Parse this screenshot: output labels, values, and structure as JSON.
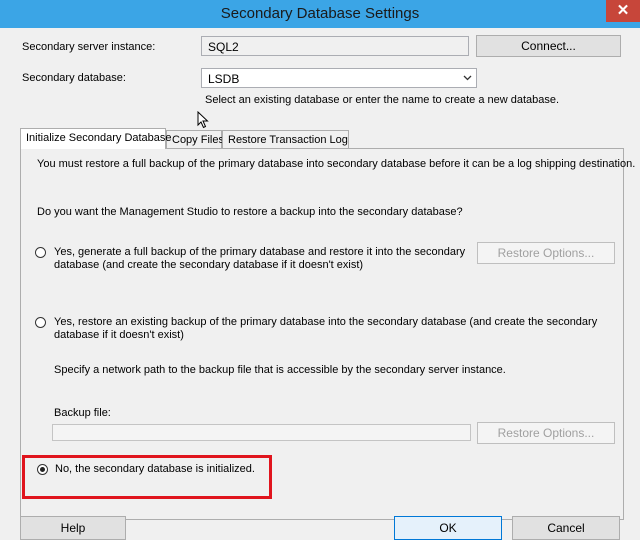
{
  "window": {
    "title": "Secondary Database Settings",
    "close_glyph": "✕"
  },
  "server": {
    "label": "Secondary server instance:",
    "value": "SQL2",
    "connect_button": "Connect..."
  },
  "database": {
    "label": "Secondary database:",
    "value": "LSDB",
    "hint": "Select an existing database or enter the name to create a new database."
  },
  "tabs": [
    {
      "label": "Initialize Secondary Database",
      "active": true
    },
    {
      "label": "Copy Files",
      "active": false
    },
    {
      "label": "Restore Transaction Log",
      "active": false
    }
  ],
  "panel": {
    "intro": "You must restore a full backup of the primary database into secondary database before it can be a log shipping destination.",
    "question": "Do you want the Management Studio to restore a backup into the secondary database?",
    "option1": {
      "line1": "Yes, generate a full backup of the primary database and restore it into the secondary",
      "line2": "database (and create the secondary database if it doesn't exist)",
      "checked": false,
      "button": "Restore Options..."
    },
    "option2": {
      "line1": "Yes, restore an existing backup of the primary database into the secondary database (and create the secondary",
      "line2": "database if it doesn't exist)",
      "checked": false,
      "path_hint": "Specify a network path to the backup file that is accessible by the secondary server instance.",
      "backup_label": "Backup file:",
      "backup_value": "",
      "button": "Restore Options..."
    },
    "option3": {
      "label": "No, the secondary database is initialized.",
      "checked": true
    }
  },
  "footer": {
    "help": "Help",
    "ok": "OK",
    "cancel": "Cancel"
  },
  "colors": {
    "title_bar": "#3ba5e6",
    "close_button": "#c7463a",
    "highlight_box": "#e0141d"
  }
}
